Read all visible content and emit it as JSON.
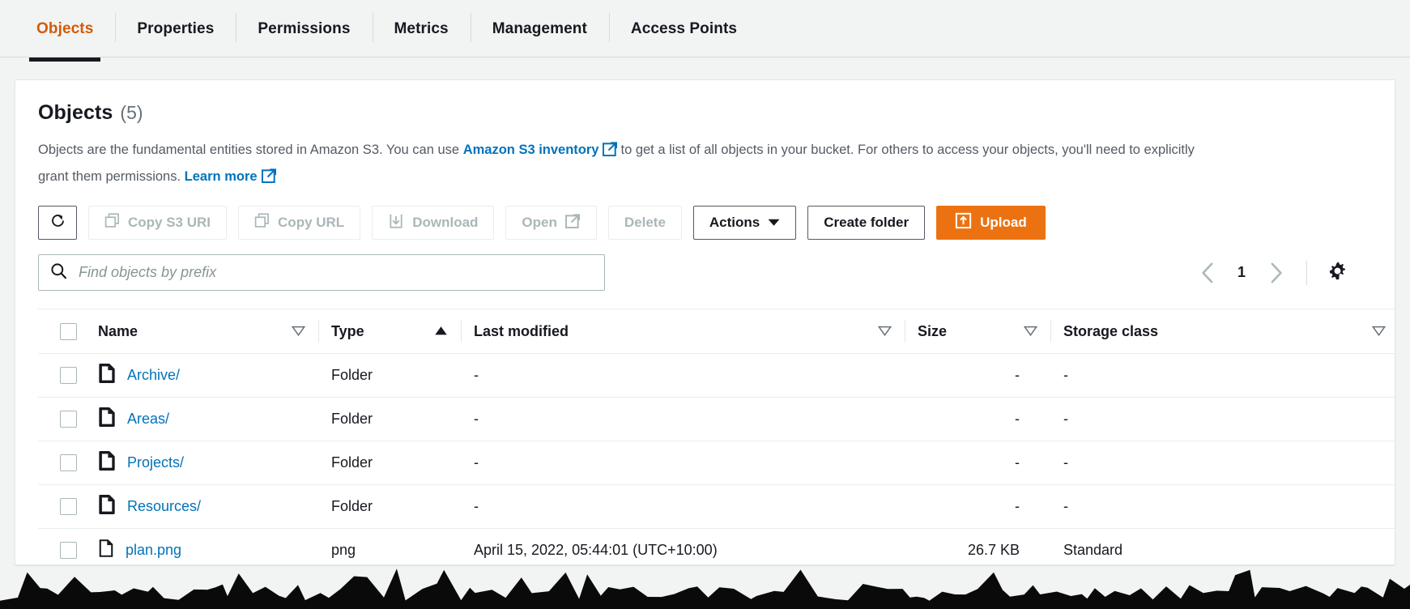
{
  "tabs": [
    {
      "label": "Objects",
      "active": true
    },
    {
      "label": "Properties",
      "active": false
    },
    {
      "label": "Permissions",
      "active": false
    },
    {
      "label": "Metrics",
      "active": false
    },
    {
      "label": "Management",
      "active": false
    },
    {
      "label": "Access Points",
      "active": false
    }
  ],
  "panel": {
    "title": "Objects",
    "count": "(5)",
    "description_part1": "Objects are the fundamental entities stored in Amazon S3. You can use",
    "inventory_link": "Amazon S3 inventory",
    "description_part2": "to get a list of all objects in your bucket. For others to access your objects, you'll need to explicitly grant them permissions.",
    "learn_more_link": "Learn more"
  },
  "toolbar": {
    "refresh_label": "refresh-icon",
    "copy_s3_uri": "Copy S3 URI",
    "copy_url": "Copy URL",
    "download": "Download",
    "open": "Open",
    "delete": "Delete",
    "actions": "Actions",
    "create_folder": "Create folder",
    "upload": "Upload"
  },
  "search": {
    "placeholder": "Find objects by prefix",
    "value": ""
  },
  "pagination": {
    "prev": "‹",
    "page": "1",
    "next": "›"
  },
  "table": {
    "columns": [
      {
        "label": "Name",
        "sort": "none"
      },
      {
        "label": "Type",
        "sort": "asc"
      },
      {
        "label": "Last modified",
        "sort": "none"
      },
      {
        "label": "Size",
        "sort": "none"
      },
      {
        "label": "Storage class",
        "sort": "none"
      }
    ],
    "rows": [
      {
        "icon": "folder-icon",
        "name": "Archive/",
        "type": "Folder",
        "last_modified": "-",
        "size": "-",
        "storage_class": "-"
      },
      {
        "icon": "folder-icon",
        "name": "Areas/",
        "type": "Folder",
        "last_modified": "-",
        "size": "-",
        "storage_class": "-"
      },
      {
        "icon": "folder-icon",
        "name": "Projects/",
        "type": "Folder",
        "last_modified": "-",
        "size": "-",
        "storage_class": "-"
      },
      {
        "icon": "folder-icon",
        "name": "Resources/",
        "type": "Folder",
        "last_modified": "-",
        "size": "-",
        "storage_class": "-"
      },
      {
        "icon": "file-icon",
        "name": "plan.png",
        "type": "png",
        "last_modified": "April 15, 2022, 05:44:01 (UTC+10:00)",
        "size": "26.7 KB",
        "storage_class": "Standard"
      }
    ]
  },
  "colors": {
    "accent_orange": "#ec7211",
    "active_tab_text": "#d45b07",
    "link_blue": "#0073bb",
    "page_bg": "#f2f3f3",
    "text_dark": "#16191f",
    "text_muted": "#545b64",
    "disabled": "#aab7b8"
  }
}
